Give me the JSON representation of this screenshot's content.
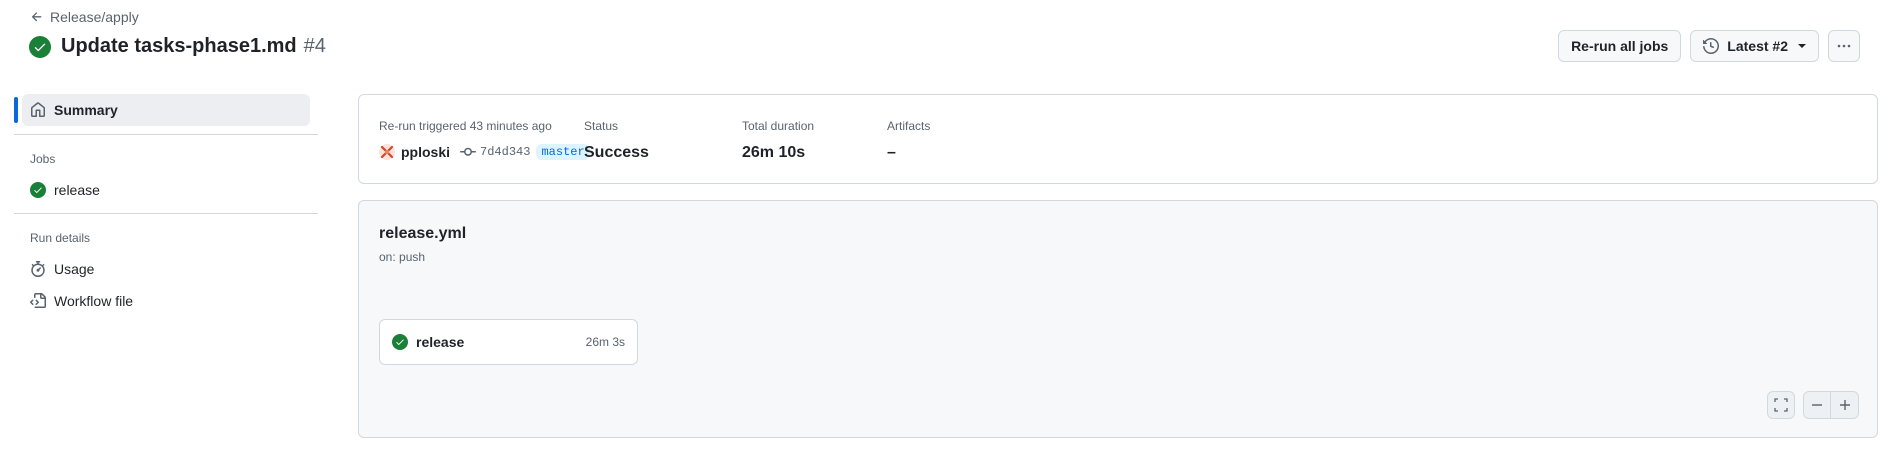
{
  "header": {
    "back_label": "Release/apply",
    "title": "Update tasks-phase1.md",
    "run_number": "#4",
    "rerun_all_label": "Re-run all jobs",
    "attempt_label": "Latest #2"
  },
  "sidebar": {
    "summary_label": "Summary",
    "jobs_heading": "Jobs",
    "jobs": [
      {
        "label": "release"
      }
    ],
    "run_details_heading": "Run details",
    "usage_label": "Usage",
    "workflow_file_label": "Workflow file"
  },
  "summary": {
    "trigger_label": "Re-run triggered 43 minutes ago",
    "actor": "pploski",
    "commit_sha": "7d4d343",
    "branch": "master",
    "status_label": "Status",
    "status_value": "Success",
    "duration_label": "Total duration",
    "duration_value": "26m 10s",
    "artifacts_label": "Artifacts",
    "artifacts_value": "–"
  },
  "graph": {
    "workflow_name": "release.yml",
    "trigger": "on: push",
    "jobs": [
      {
        "name": "release",
        "duration": "26m 3s"
      }
    ]
  },
  "colors": {
    "success": "#1a7f37",
    "accent": "#0969da",
    "muted_text": "#59636e",
    "border": "#d1d9e0"
  }
}
